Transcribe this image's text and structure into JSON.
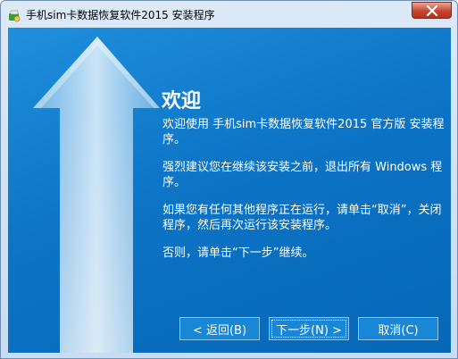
{
  "window": {
    "title": "手机sim卡数据恢复软件2015 安装程序"
  },
  "icons": {
    "app": "installer-app-icon",
    "close": "close-icon",
    "arrow": "up-arrow-graphic"
  },
  "colors": {
    "client_background": "#0d74c6",
    "close_button": "#c9452f"
  },
  "content": {
    "heading": "欢迎",
    "p1": "欢迎使用 手机sim卡数据恢复软件2015 官方版 安装程序。",
    "p2": "强烈建议您在继续该安装之前，退出所有 Windows 程序。",
    "p3": "如果您有任何其他程序正在运行，请单击“取消”，关闭程序，然后再次运行该安装程序。",
    "p4": "否则，请单击“下一步”继续。"
  },
  "buttons": {
    "back": "< 返回(B)",
    "next": "下一步(N) >",
    "cancel": "取消(C)"
  }
}
